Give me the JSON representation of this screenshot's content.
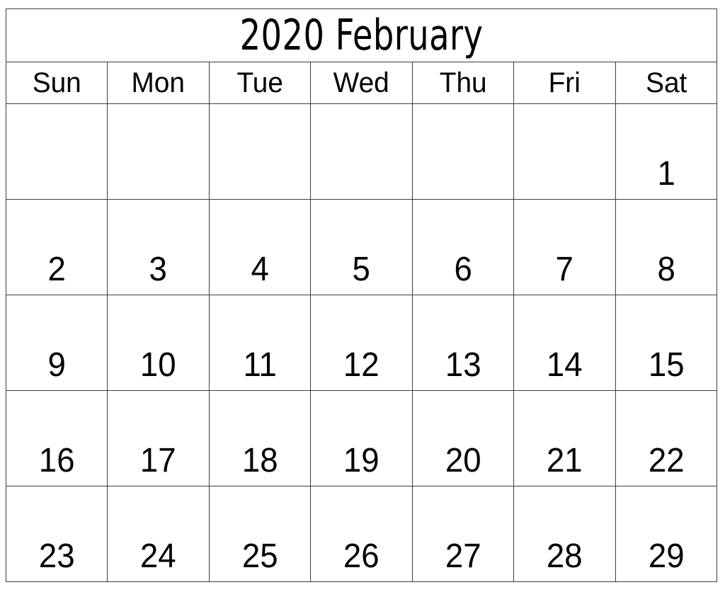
{
  "calendar": {
    "title": "2020 February",
    "year": "2020",
    "month": "February",
    "weekday_headers": [
      {
        "label": "Sun"
      },
      {
        "label": "Mon"
      },
      {
        "label": "Tue"
      },
      {
        "label": "Wed"
      },
      {
        "label": "Thu"
      },
      {
        "label": "Fri"
      },
      {
        "label": "Sat"
      }
    ],
    "weeks": [
      {
        "days": [
          {
            "date": ""
          },
          {
            "date": ""
          },
          {
            "date": ""
          },
          {
            "date": ""
          },
          {
            "date": ""
          },
          {
            "date": ""
          },
          {
            "date": "1"
          }
        ]
      },
      {
        "days": [
          {
            "date": "2"
          },
          {
            "date": "3"
          },
          {
            "date": "4"
          },
          {
            "date": "5"
          },
          {
            "date": "6"
          },
          {
            "date": "7"
          },
          {
            "date": "8"
          }
        ]
      },
      {
        "days": [
          {
            "date": "9"
          },
          {
            "date": "10"
          },
          {
            "date": "11"
          },
          {
            "date": "12"
          },
          {
            "date": "13"
          },
          {
            "date": "14"
          },
          {
            "date": "15"
          }
        ]
      },
      {
        "days": [
          {
            "date": "16"
          },
          {
            "date": "17"
          },
          {
            "date": "18"
          },
          {
            "date": "19"
          },
          {
            "date": "20"
          },
          {
            "date": "21"
          },
          {
            "date": "22"
          }
        ]
      },
      {
        "days": [
          {
            "date": "23"
          },
          {
            "date": "24"
          },
          {
            "date": "25"
          },
          {
            "date": "26"
          },
          {
            "date": "27"
          },
          {
            "date": "28"
          },
          {
            "date": "29"
          }
        ]
      }
    ],
    "colors": {
      "border": "#3d3d3d",
      "text": "#000000",
      "background": "#ffffff"
    }
  }
}
